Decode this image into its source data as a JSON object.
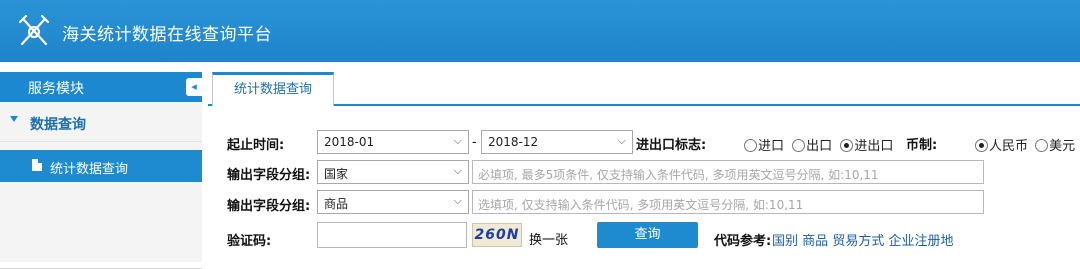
{
  "app": {
    "title": "海关统计数据在线查询平台"
  },
  "sidebar": {
    "header": "服务模块",
    "group": "数据查询",
    "item": "统计数据查询"
  },
  "tab": {
    "label": "统计数据查询"
  },
  "form": {
    "time_label": "起止时间:",
    "start": "2018-01",
    "dash": "-",
    "end": "2018-12",
    "flag_label": "进出口标志:",
    "flag_options": [
      "进口",
      "出口",
      "进出口"
    ],
    "flag_selected": "进出口",
    "currency_label": "币制:",
    "currency_options": [
      "人民币",
      "美元"
    ],
    "currency_selected": "人民币",
    "group1_label": "输出字段分组:",
    "group1_value": "国家",
    "group1_placeholder": "必填项, 最多5项条件, 仅支持输入条件代码, 多项用英文逗号分隔, 如:10,11",
    "group2_label": "输出字段分组:",
    "group2_value": "商品",
    "group2_placeholder": "选填项, 仅支持输入条件代码, 多项用英文逗号分隔, 如:10,11",
    "captcha_label": "验证码:",
    "captcha_text": "260N",
    "refresh_captcha": "换一张",
    "query_button": "查询",
    "ref_label": "代码参考:",
    "ref_links": [
      "国别",
      "商品",
      "贸易方式",
      "企业注册地"
    ]
  }
}
